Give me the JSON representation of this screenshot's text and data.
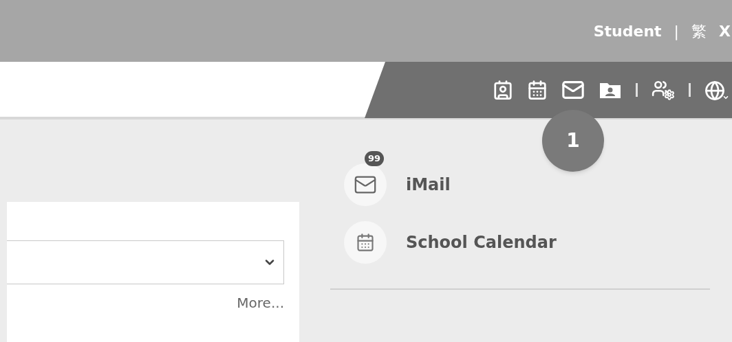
{
  "top_bar": {
    "user_role": "Student",
    "separator": "|",
    "language": "繁",
    "close_partial": "X"
  },
  "toolbar": {
    "tools": [
      {
        "kind": "contact"
      },
      {
        "kind": "calendar"
      },
      {
        "kind": "mail"
      },
      {
        "kind": "folder"
      },
      {
        "kind": "divider"
      },
      {
        "kind": "people-settings"
      },
      {
        "kind": "divider"
      },
      {
        "kind": "globe"
      }
    ]
  },
  "callout": {
    "number": "1"
  },
  "panel": {
    "link": "More..."
  },
  "apps": [
    {
      "kind": "mail",
      "label": "iMail",
      "badge": "99"
    },
    {
      "kind": "calendar",
      "label": "School Calendar"
    }
  ]
}
